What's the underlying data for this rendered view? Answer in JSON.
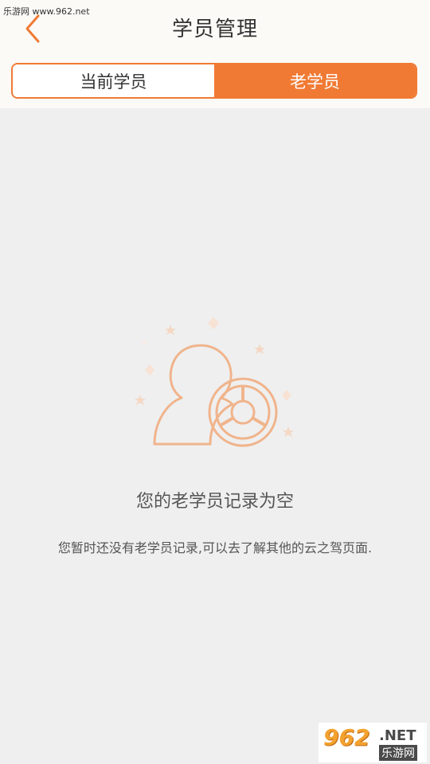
{
  "watermark": {
    "text": "乐游网 www.962.net"
  },
  "header": {
    "title": "学员管理"
  },
  "tabs": [
    {
      "label": "当前学员",
      "active": false
    },
    {
      "label": "老学员",
      "active": true
    }
  ],
  "empty_state": {
    "title": "您的老学员记录为空",
    "description": "您暂时还没有老学员记录,可以去了解其他的云之驾页面."
  },
  "logo": {
    "number": "962",
    "net": ".NET",
    "name": "乐游网"
  },
  "colors": {
    "accent": "#f07a34",
    "background": "#efefef",
    "header_bg": "#fbfaf6",
    "illustration": "#f0b48c"
  },
  "icons": {
    "back": "chevron-left-icon",
    "illustration": "empty-students-illustration"
  }
}
